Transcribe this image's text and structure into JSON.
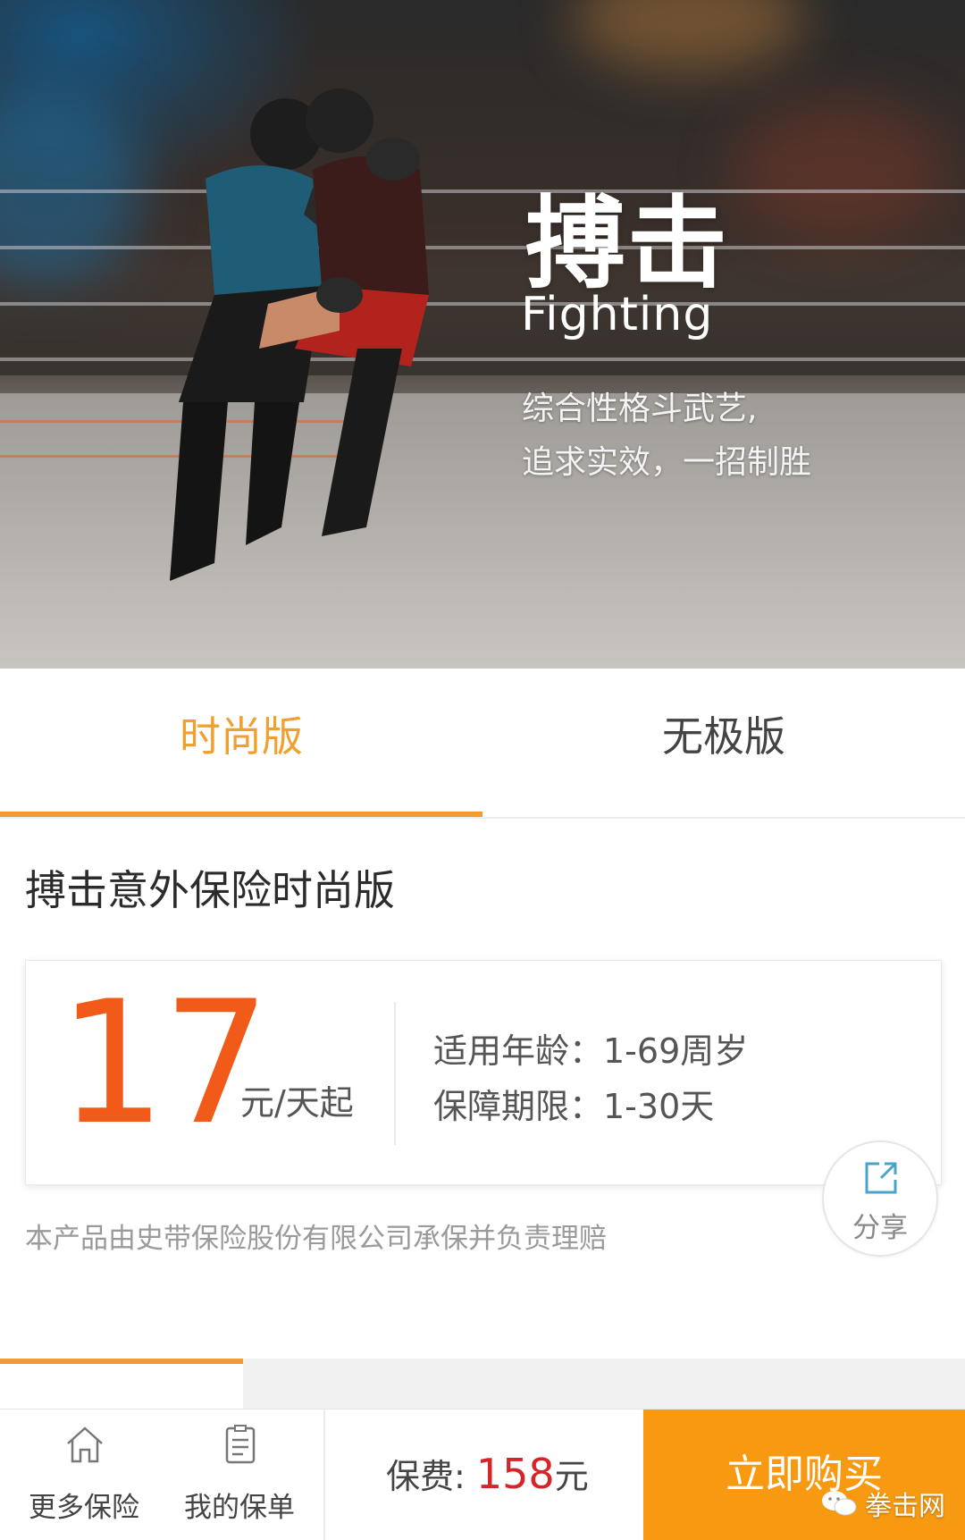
{
  "hero": {
    "title": "搏击",
    "subtitle": "Fighting",
    "tagline_line1": "综合性格斗武艺,",
    "tagline_line2": "追求实效，一招制胜"
  },
  "tabs": [
    {
      "label": "时尚版",
      "active": true
    },
    {
      "label": "无极版",
      "active": false
    }
  ],
  "product": {
    "name": "搏击意外保险时尚版",
    "price": "17",
    "price_unit": "元/天起",
    "age": "适用年龄：1-69周岁",
    "period": "保障期限：1-30天",
    "underwriter": "本产品由史带保险股份有限公司承保并负责理赔"
  },
  "share": {
    "label": "分享",
    "icon": "share-icon"
  },
  "bottom_bar": {
    "more_label": "更多保险",
    "mine_label": "我的保单",
    "premium_prefix": "保费: ",
    "premium_amount": "158",
    "premium_suffix": "元",
    "buy_label": "立即购买"
  },
  "watermark": "拳击网",
  "colors": {
    "accent_orange": "#f29b35",
    "price_orange": "#f25a19",
    "premium_red": "#d6252a",
    "buy_button": "#f79a12"
  }
}
